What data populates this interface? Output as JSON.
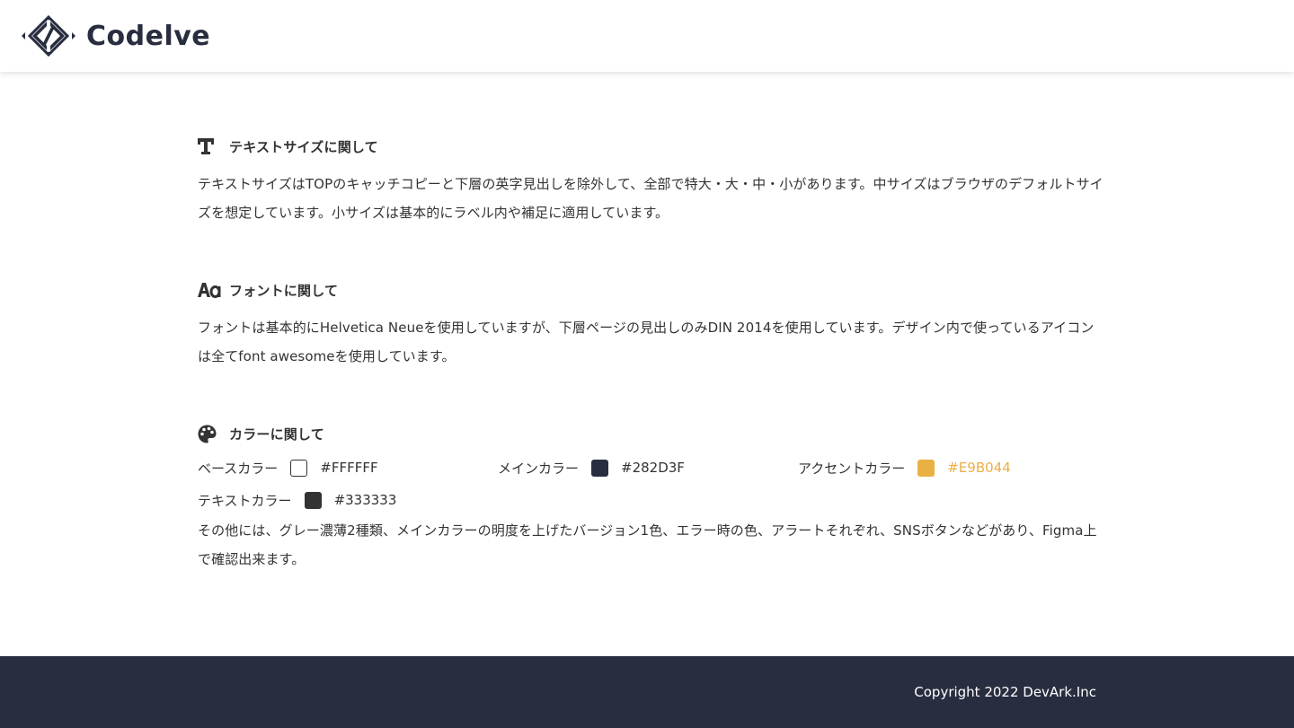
{
  "header": {
    "logo_text": "Codelve"
  },
  "sections": [
    {
      "icon": "text-t-icon",
      "title": "テキストサイズに関して",
      "body": "テキストサイズはTOPのキャッチコピーと下層の英字見出しを除外して、全部で特大・大・中・小があります。中サイズはブラウザのデフォルトサイズを想定しています。小サイズは基本的にラベル内や補足に適用しています。"
    },
    {
      "icon": "font-aa-icon",
      "title": "フォントに関して",
      "body": "フォントは基本的にHelvetica Neueを使用していますが、下層ページの見出しのみDIN 2014を使用しています。デザイン内で使っているアイコンは全てfont awesomeを使用しています。"
    },
    {
      "icon": "palette-icon",
      "title": "カラーに関して",
      "colors": [
        {
          "label": "ベースカラー",
          "hex": "#FFFFFF",
          "code": "#FFFFFF"
        },
        {
          "label": "メインカラー",
          "hex": "#282D3F",
          "code": "#282D3F"
        },
        {
          "label": "アクセントカラー",
          "hex": "#E9B044",
          "code": "#E9B044"
        },
        {
          "label": "テキストカラー",
          "hex": "#333333",
          "code": "#333333"
        }
      ],
      "body": "その他には、グレー濃薄2種類、メインカラーの明度を上げたバージョン1色、エラー時の色、アラートそれぞれ、SNSボタンなどがあり、Figma上で確認出来ます。"
    }
  ],
  "footer": {
    "copyright": "Copyright 2022 DevArk.Inc"
  },
  "colors": {
    "main": "#282D3F",
    "accent": "#E9B044",
    "text": "#333333",
    "base": "#FFFFFF"
  }
}
